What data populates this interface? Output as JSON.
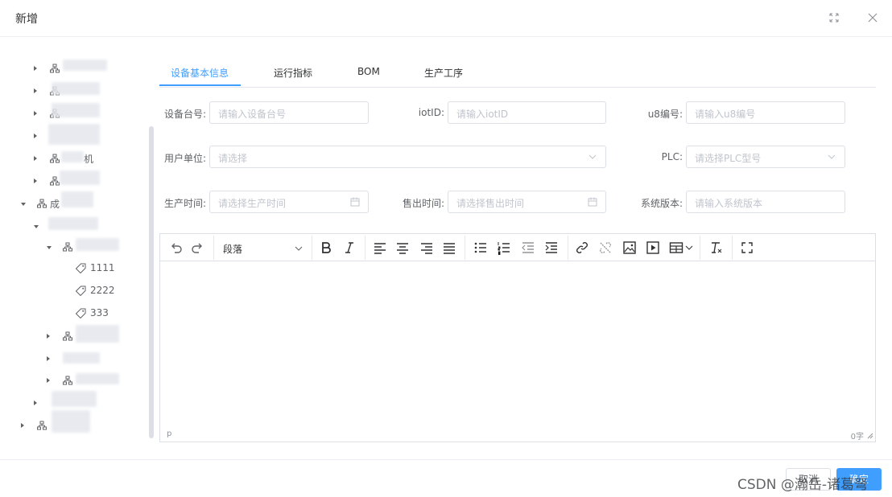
{
  "dialog": {
    "title": "新增"
  },
  "tree": {
    "nodes": [
      {
        "label": "",
        "level": 1
      },
      {
        "label": "",
        "level": 1
      },
      {
        "label": "",
        "level": 1
      },
      {
        "label": "",
        "level": 1
      },
      {
        "label": "机",
        "level": 1
      },
      {
        "label": "",
        "level": 1
      },
      {
        "label": "成",
        "level": 0
      },
      {
        "label": "",
        "level": 1
      },
      {
        "label": "",
        "level": 2
      },
      {
        "label": "",
        "level": 2
      },
      {
        "label": "",
        "level": 2
      },
      {
        "label": "",
        "level": 2
      },
      {
        "label": "",
        "level": 1
      },
      {
        "label": "",
        "level": 0
      }
    ],
    "leaves": [
      "1111",
      "2222",
      "333"
    ]
  },
  "tabs": [
    "设备基本信息",
    "运行指标",
    "BOM",
    "生产工序"
  ],
  "form": {
    "device_no": {
      "label": "设备台号:",
      "placeholder": "请输入设备台号"
    },
    "iot_id": {
      "label": "iotID:",
      "placeholder": "请输入iotID"
    },
    "u8_no": {
      "label": "u8编号:",
      "placeholder": "请输入u8编号"
    },
    "user_unit": {
      "label": "用户单位:",
      "placeholder": "请选择"
    },
    "plc": {
      "label": "PLC:",
      "placeholder": "请选择PLC型号"
    },
    "prod_time": {
      "label": "生产时间:",
      "placeholder": "请选择生产时间"
    },
    "sale_time": {
      "label": "售出时间:",
      "placeholder": "请选择售出时间"
    },
    "sys_version": {
      "label": "系统版本:",
      "placeholder": "请输入系统版本"
    }
  },
  "editor": {
    "block_format": "段落",
    "status_path": "p",
    "word_count": "0字"
  },
  "footer": {
    "cancel": "取消",
    "ok": "确定"
  },
  "watermark": "CSDN @瀚岳-诸葛弩",
  "colors": {
    "accent": "#409eff",
    "border": "#dcdfe6"
  }
}
